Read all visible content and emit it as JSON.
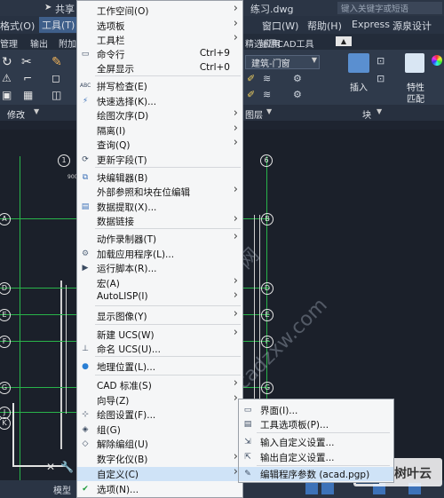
{
  "title_bar": {
    "share_label": "共享",
    "filename": "练习.dwg",
    "search_placeholder": "键入关键字或短语"
  },
  "menubar": {
    "left_items": [
      "格式(O)",
      "工具(T)"
    ],
    "right_items": [
      "窗口(W)",
      "帮助(H)",
      "Express",
      "源泉设计"
    ]
  },
  "ribbon_tabs": [
    "管理",
    "输出",
    "附加",
    "精选应用",
    "赫思CAD工具"
  ],
  "ribbon": {
    "modify_label": "修改",
    "layer_label": "图层",
    "block_label": "块",
    "layer_name": "建筑-门窗",
    "insert_label": "插入",
    "properties_label": "特性",
    "match_label": "匹配"
  },
  "main_menu": {
    "items": [
      {
        "label": "工作空间(O)",
        "shortcut": "",
        "submenu": true,
        "icon": ""
      },
      {
        "label": "选项板",
        "shortcut": "",
        "submenu": true,
        "icon": ""
      },
      {
        "label": "工具栏",
        "shortcut": "",
        "submenu": true,
        "icon": ""
      },
      {
        "label": "命令行",
        "shortcut": "Ctrl+9",
        "submenu": false,
        "icon": "command-line-icon"
      },
      {
        "label": "全屏显示",
        "shortcut": "Ctrl+0",
        "submenu": false,
        "icon": ""
      },
      {
        "label": "拼写检查(E)",
        "shortcut": "",
        "submenu": false,
        "icon": "spell-check-icon"
      },
      {
        "label": "快速选择(K)...",
        "shortcut": "",
        "submenu": false,
        "icon": "quick-select-icon"
      },
      {
        "label": "绘图次序(D)",
        "shortcut": "",
        "submenu": true,
        "icon": ""
      },
      {
        "label": "隔离(I)",
        "shortcut": "",
        "submenu": true,
        "icon": ""
      },
      {
        "label": "查询(Q)",
        "shortcut": "",
        "submenu": true,
        "icon": ""
      },
      {
        "label": "更新字段(T)",
        "shortcut": "",
        "submenu": false,
        "icon": "update-field-icon"
      },
      {
        "label": "块编辑器(B)",
        "shortcut": "",
        "submenu": false,
        "icon": "block-editor-icon"
      },
      {
        "label": "外部参照和块在位编辑",
        "shortcut": "",
        "submenu": true,
        "icon": ""
      },
      {
        "label": "数据提取(X)...",
        "shortcut": "",
        "submenu": false,
        "icon": "data-extraction-icon"
      },
      {
        "label": "数据链接",
        "shortcut": "",
        "submenu": true,
        "icon": ""
      },
      {
        "label": "动作录制器(T)",
        "shortcut": "",
        "submenu": true,
        "icon": ""
      },
      {
        "label": "加载应用程序(L)...",
        "shortcut": "",
        "submenu": false,
        "icon": "load-app-icon"
      },
      {
        "label": "运行脚本(R)...",
        "shortcut": "",
        "submenu": false,
        "icon": "run-script-icon"
      },
      {
        "label": "宏(A)",
        "shortcut": "",
        "submenu": true,
        "icon": ""
      },
      {
        "label": "AutoLISP(I)",
        "shortcut": "",
        "submenu": true,
        "icon": ""
      },
      {
        "label": "显示图像(Y)",
        "shortcut": "",
        "submenu": true,
        "icon": ""
      },
      {
        "label": "新建 UCS(W)",
        "shortcut": "",
        "submenu": true,
        "icon": ""
      },
      {
        "label": "命名 UCS(U)...",
        "shortcut": "",
        "submenu": false,
        "icon": "named-ucs-icon"
      },
      {
        "label": "地理位置(L)...",
        "shortcut": "",
        "submenu": false,
        "icon": "globe-icon"
      },
      {
        "label": "CAD 标准(S)",
        "shortcut": "",
        "submenu": true,
        "icon": ""
      },
      {
        "label": "向导(Z)",
        "shortcut": "",
        "submenu": true,
        "icon": ""
      },
      {
        "label": "绘图设置(F)...",
        "shortcut": "",
        "submenu": false,
        "icon": "drafting-settings-icon"
      },
      {
        "label": "组(G)",
        "shortcut": "",
        "submenu": false,
        "icon": "group-icon"
      },
      {
        "label": "解除编组(U)",
        "shortcut": "",
        "submenu": false,
        "icon": "ungroup-icon"
      },
      {
        "label": "数字化仪(B)",
        "shortcut": "",
        "submenu": true,
        "icon": ""
      },
      {
        "label": "自定义(C)",
        "shortcut": "",
        "submenu": true,
        "icon": ""
      },
      {
        "label": "选项(N)...",
        "shortcut": "",
        "submenu": false,
        "icon": "options-check-icon"
      }
    ]
  },
  "sub_menu": {
    "items": [
      {
        "label": "界面(I)...",
        "icon": "interface-icon"
      },
      {
        "label": "工具选项板(P)...",
        "icon": "tool-palettes-icon"
      },
      {
        "label": "输入自定义设置...",
        "icon": "import-customization-icon"
      },
      {
        "label": "输出自定义设置...",
        "icon": "export-customization-icon"
      },
      {
        "label": "编辑程序参数 (acad.pgp)",
        "icon": "edit-pgp-icon"
      }
    ]
  },
  "drawing": {
    "axis_labels_left": [
      "A",
      "D",
      "E",
      "F",
      "G",
      "J",
      "K"
    ],
    "axis_labels_right": [
      "B",
      "D",
      "E",
      "F",
      "G"
    ],
    "top_numbers": [
      "1",
      "6"
    ],
    "dimension_text": "900"
  },
  "statusbar": {
    "model_tab": "模型"
  },
  "watermarks": [
    "CAD自学网",
    "www.cadzxw.com"
  ],
  "logo_text": "树叶云",
  "colors": {
    "menu_highlight": "#cfe3f7",
    "grid_green": "#29b34a",
    "canvas_bg": "#1b202a"
  }
}
